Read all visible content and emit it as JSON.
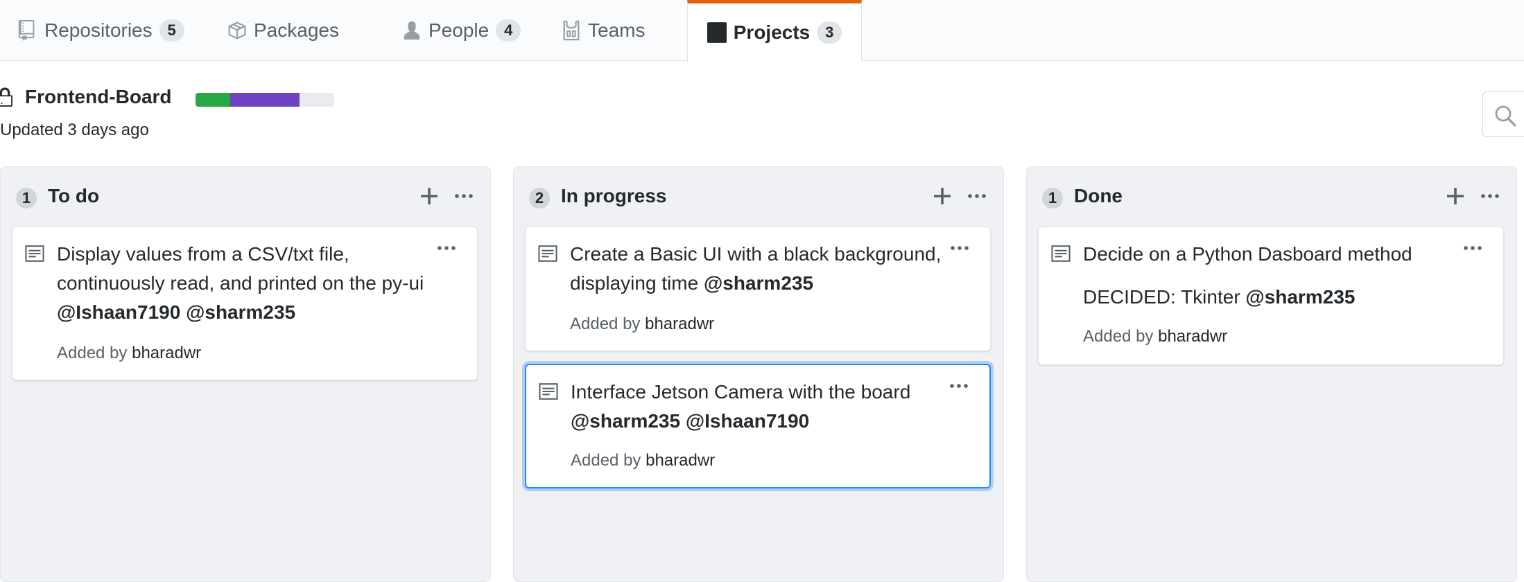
{
  "tabs": [
    {
      "label": "Repositories",
      "count": "5",
      "icon": "repo-icon"
    },
    {
      "label": "Packages",
      "icon": "package-icon"
    },
    {
      "label": "People",
      "count": "4",
      "icon": "person-icon"
    },
    {
      "label": "Teams",
      "icon": "jersey-icon"
    },
    {
      "label": "Projects",
      "count": "3",
      "icon": "project-icon",
      "selected": true
    }
  ],
  "project": {
    "name": "Frontend-Board",
    "updated": "Updated 3 days ago",
    "progress": {
      "done": 0.25,
      "in_progress": 0.5,
      "todo": 0.25
    },
    "colors": {
      "done": "#28a745",
      "in_progress": "#6f42c1",
      "todo": "#e9ebef"
    }
  },
  "columns": [
    {
      "count": "1",
      "title": "To do",
      "cards": [
        {
          "text": "Display values from a CSV/txt file, continuously read, and printed on the py-ui",
          "mentions": "@Ishaan7190 @sharm235",
          "added_prefix": "Added by",
          "added_by": "bharadwr"
        }
      ]
    },
    {
      "count": "2",
      "title": "In progress",
      "cards": [
        {
          "text": "Create a Basic UI with a black background, displaying time",
          "mentions": "@sharm235",
          "added_prefix": "Added by",
          "added_by": "bharadwr"
        },
        {
          "text": "Interface Jetson Camera with the board",
          "mentions": "@sharm235 @Ishaan7190",
          "added_prefix": "Added by",
          "added_by": "bharadwr",
          "focused": true
        }
      ]
    },
    {
      "count": "1",
      "title": "Done",
      "cards": [
        {
          "text": "Decide on a Python Dasboard method",
          "note": "DECIDED: Tkinter",
          "note_mention": "@sharm235",
          "added_prefix": "Added by",
          "added_by": "bharadwr"
        }
      ]
    }
  ]
}
